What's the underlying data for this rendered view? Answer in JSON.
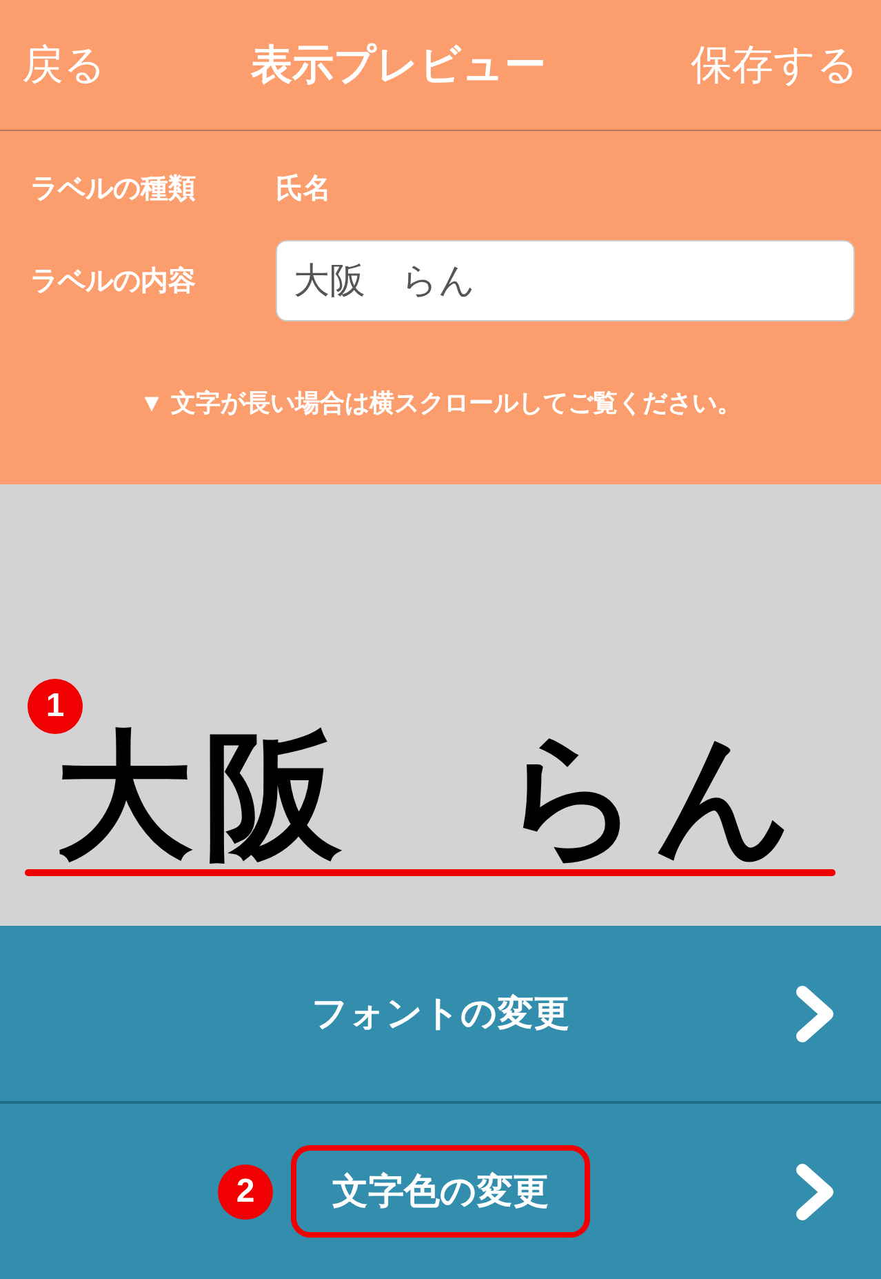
{
  "nav": {
    "back": "戻る",
    "title": "表示プレビュー",
    "save": "保存する"
  },
  "fields": [
    {
      "kind": "static",
      "label": "ラベルの種類",
      "value": "氏名"
    },
    {
      "kind": "input",
      "label": "ラベルの内容",
      "value": "大阪　らん"
    }
  ],
  "hint": "▼ 文字が長い場合は横スクロールしてご覧ください。",
  "preview": {
    "text": "大阪　らん",
    "marker": "1",
    "underlined": true
  },
  "options": [
    {
      "label": "フォントの変更",
      "highlighted": false
    },
    {
      "label": "文字色の変更",
      "highlighted": true,
      "marker": "2"
    }
  ]
}
